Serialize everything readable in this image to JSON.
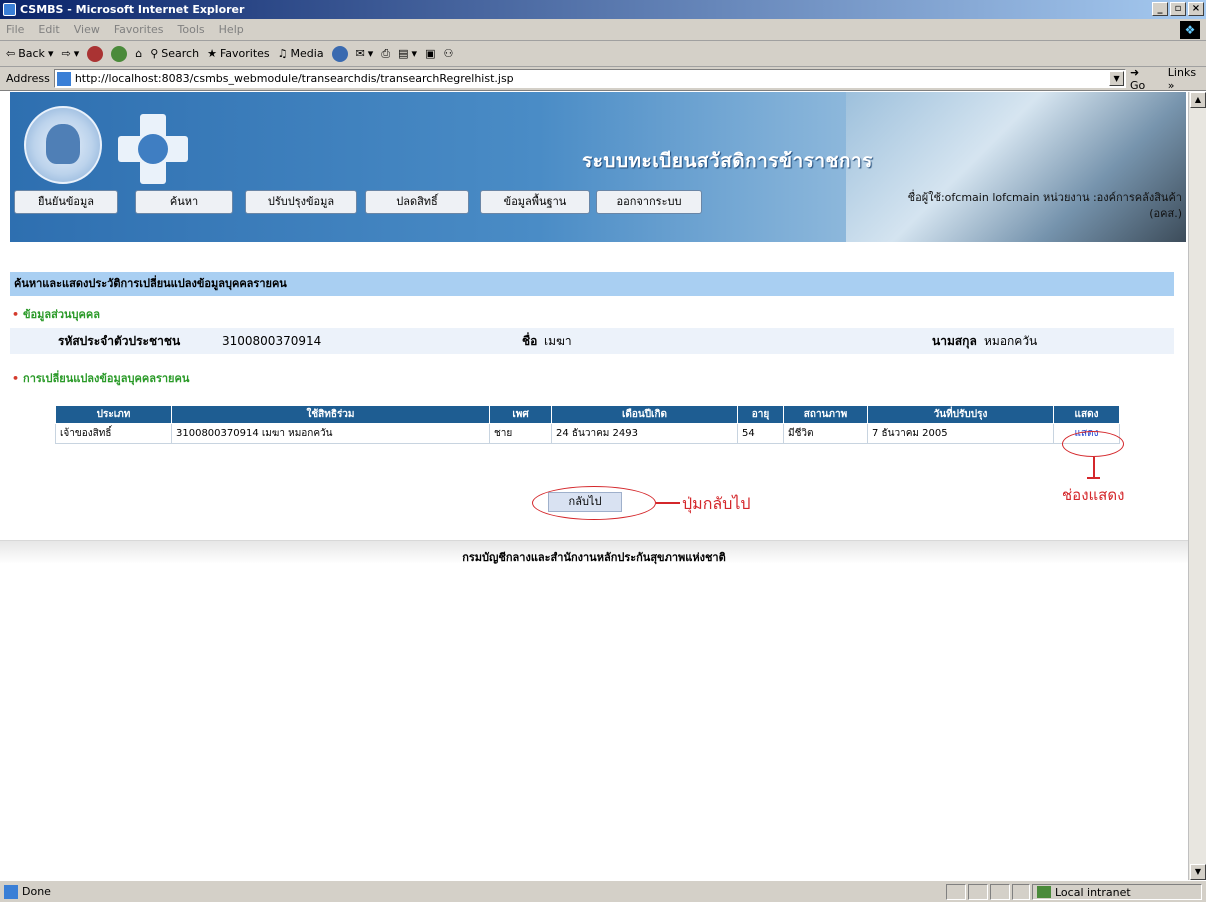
{
  "window": {
    "title": "CSMBS - Microsoft Internet Explorer",
    "min": "_",
    "max": "▫",
    "close": "×"
  },
  "menu": [
    "File",
    "Edit",
    "View",
    "Favorites",
    "Tools",
    "Help"
  ],
  "toolbar": {
    "back": "Back",
    "search": "Search",
    "favorites": "Favorites",
    "media": "Media"
  },
  "address": {
    "label": "Address",
    "url": "http://localhost:8083/csmbs_webmodule/transearchdis/transearchRegrelhist.jsp",
    "go": "Go",
    "links": "Links »"
  },
  "banner": {
    "title": "ระบบทะเบียนสวัสดิการข้าราชการ"
  },
  "nav": [
    "ยืนยันข้อมูล",
    "ค้นหา",
    "ปรับปรุงข้อมูล",
    "ปลดสิทธิ์",
    "ข้อมูลพื้นฐาน",
    "ออกจากระบบ"
  ],
  "user": {
    "line1": "ชื่อผู้ใช้:ofcmain lofcmain หน่วยงาน :องค์การคลังสินค้า",
    "line2": "(อคส.)"
  },
  "section": {
    "title": "ค้นหาและแสดงประวัติการเปลี่ยนแปลงข้อมูลบุคคลรายคน"
  },
  "personal": {
    "heading": "ข้อมูลส่วนบุคคล",
    "id_label": "รหัสประจำตัวประชาชน",
    "id_value": "3100800370914",
    "name_label": "ชื่อ",
    "name_value": "เมฆา",
    "surname_label": "นามสกุล",
    "surname_value": "หมอกควัน"
  },
  "changes": {
    "heading": "การเปลี่ยนแปลงข้อมูลบุคคลรายคน"
  },
  "table": {
    "headers": [
      "ประเภท",
      "ใช้สิทธิร่วม",
      "เพศ",
      "เดือนปีเกิด",
      "อายุ",
      "สถานภาพ",
      "วันที่ปรับปรุง",
      "แสดง"
    ],
    "rows": [
      [
        "เจ้าของสิทธิ์",
        "3100800370914 เมฆา หมอกควัน",
        "ชาย",
        "24 ธันวาคม 2493",
        "54",
        "มีชีวิต",
        "7 ธันวาคม 2005",
        "แสดง"
      ]
    ]
  },
  "back_button": "กลับไป",
  "annotations": {
    "back": "ปุ่มกลับไป",
    "show": "ช่องแสดง"
  },
  "footer": "กรมบัญชีกลางและสำนักงานหลักประกันสุขภาพแห่งชาติ",
  "status": {
    "text": "Done",
    "zone": "Local intranet"
  },
  "colors": {
    "header_blue": "#1e5d92",
    "section_bar": "#a9cff2",
    "annotation_red": "#d4272b",
    "heading_green": "#2a9a28"
  }
}
